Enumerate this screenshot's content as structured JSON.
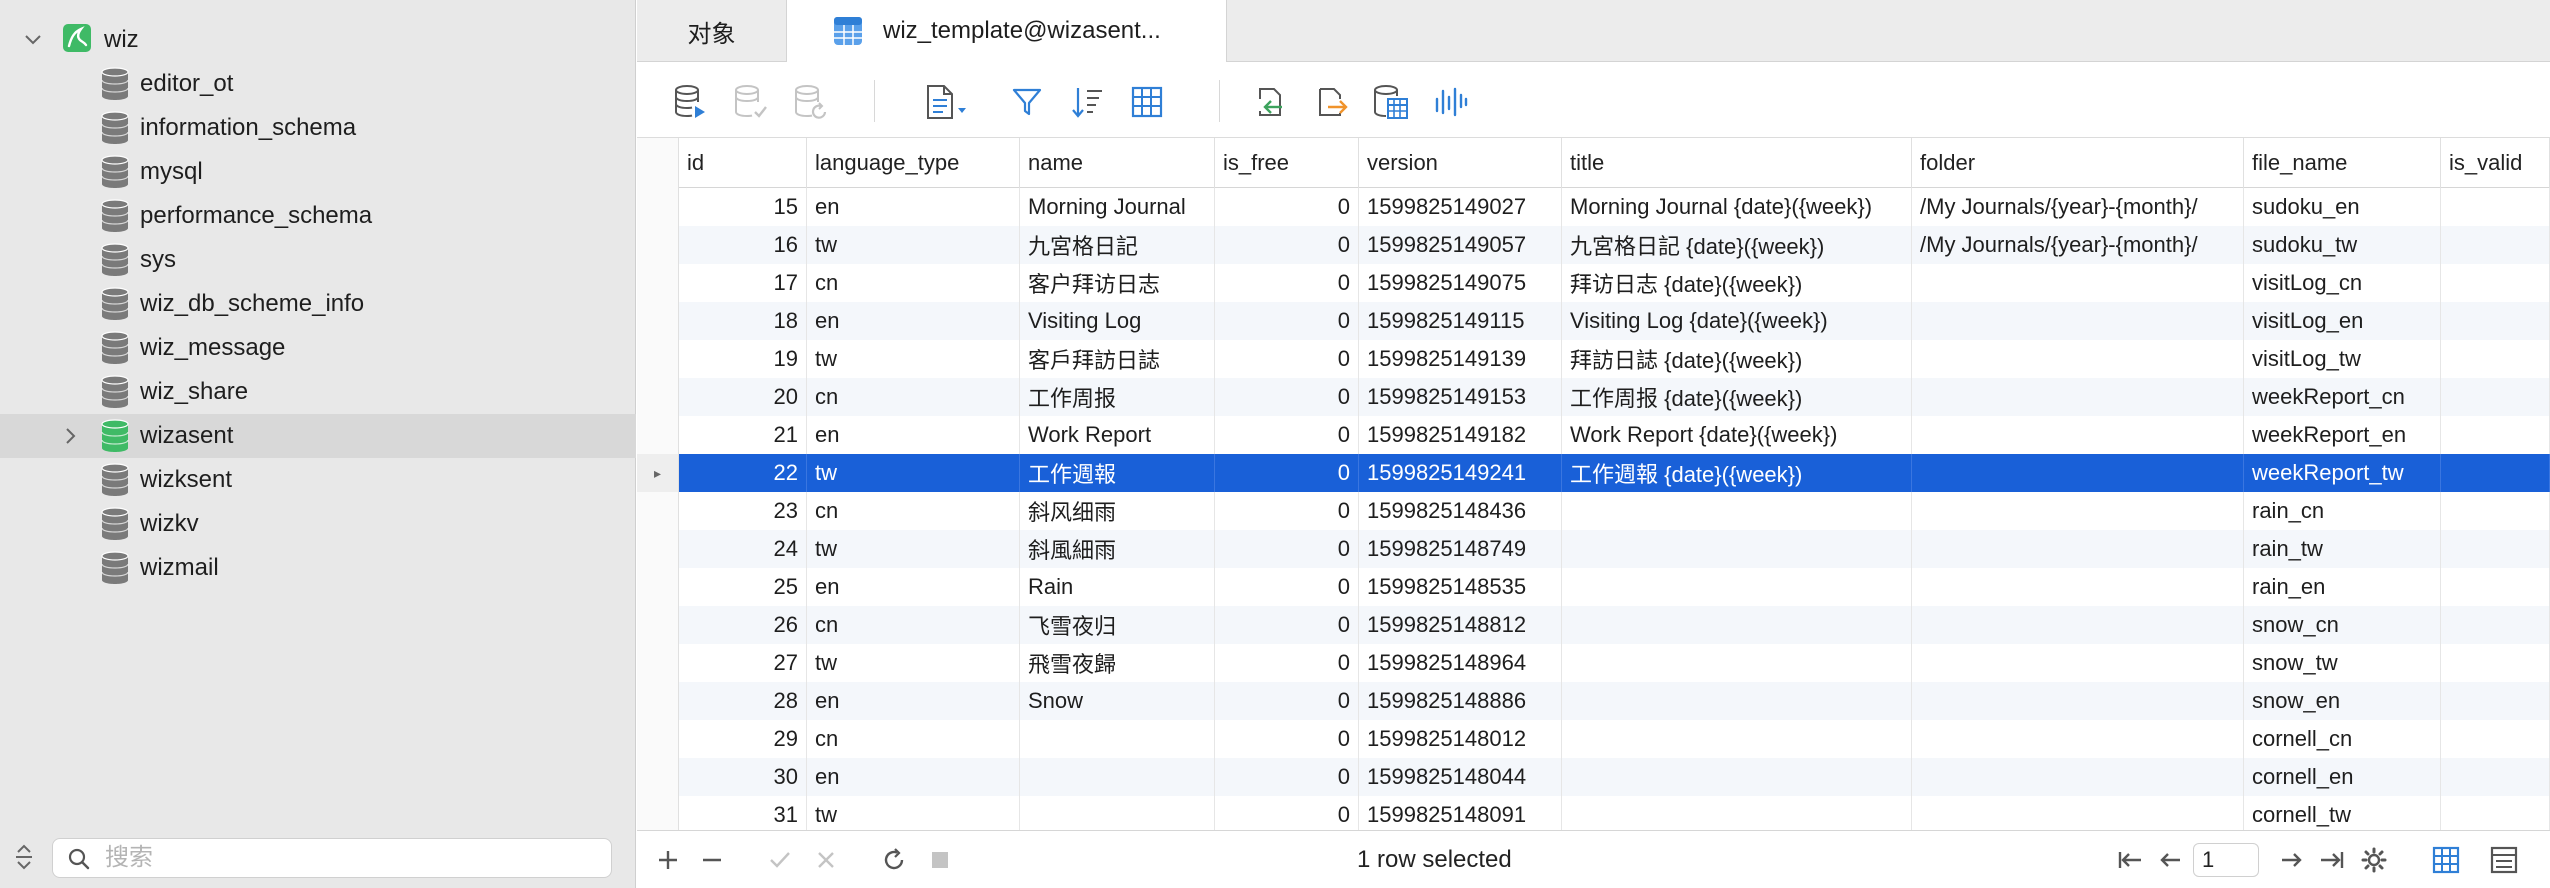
{
  "sidebar": {
    "root": {
      "label": "wiz"
    },
    "items": [
      {
        "label": "editor_ot"
      },
      {
        "label": "information_schema"
      },
      {
        "label": "mysql"
      },
      {
        "label": "performance_schema"
      },
      {
        "label": "sys"
      },
      {
        "label": "wiz_db_scheme_info"
      },
      {
        "label": "wiz_message"
      },
      {
        "label": "wiz_share"
      },
      {
        "label": "wizasent",
        "selected": true,
        "icon_color": "#3fba66"
      },
      {
        "label": "wizksent"
      },
      {
        "label": "wizkv"
      },
      {
        "label": "wizmail"
      }
    ],
    "search": {
      "placeholder": "搜索"
    }
  },
  "tabs": [
    {
      "label": "对象"
    },
    {
      "label": "wiz_template@wizasent..."
    }
  ],
  "toolbar": {
    "buttons": [
      {
        "icon": "database-run-icon"
      },
      {
        "icon": "database-stop-icon"
      },
      {
        "icon": "database-refresh-icon"
      },
      {
        "icon": "document-menu-icon"
      },
      {
        "icon": "filter-icon"
      },
      {
        "icon": "sort-icon"
      },
      {
        "icon": "grid-icon"
      },
      {
        "icon": "import-icon"
      },
      {
        "icon": "export-icon"
      },
      {
        "icon": "database-table-icon"
      },
      {
        "icon": "chart-icon"
      }
    ]
  },
  "grid": {
    "columns": [
      "id",
      "language_type",
      "name",
      "is_free",
      "version",
      "title",
      "folder",
      "file_name",
      "is_valid"
    ],
    "selected_index": 7,
    "rows": [
      {
        "id": "15",
        "language_type": "en",
        "name": "Morning Journal",
        "is_free": "0",
        "version": "1599825149027",
        "title": "Morning Journal {date}({week})",
        "folder": "/My Journals/{year}-{month}/",
        "file_name": "sudoku_en",
        "is_valid": ""
      },
      {
        "id": "16",
        "language_type": "tw",
        "name": "九宮格日記",
        "is_free": "0",
        "version": "1599825149057",
        "title": "九宮格日記 {date}({week})",
        "folder": "/My Journals/{year}-{month}/",
        "file_name": "sudoku_tw",
        "is_valid": ""
      },
      {
        "id": "17",
        "language_type": "cn",
        "name": "客户拜访日志",
        "is_free": "0",
        "version": "1599825149075",
        "title": "拜访日志 {date}({week})",
        "folder": "",
        "file_name": "visitLog_cn",
        "is_valid": ""
      },
      {
        "id": "18",
        "language_type": "en",
        "name": "Visiting Log",
        "is_free": "0",
        "version": "1599825149115",
        "title": "Visiting Log {date}({week})",
        "folder": "",
        "file_name": "visitLog_en",
        "is_valid": ""
      },
      {
        "id": "19",
        "language_type": "tw",
        "name": "客戶拜訪日誌",
        "is_free": "0",
        "version": "1599825149139",
        "title": "拜訪日誌 {date}({week})",
        "folder": "",
        "file_name": "visitLog_tw",
        "is_valid": ""
      },
      {
        "id": "20",
        "language_type": "cn",
        "name": "工作周报",
        "is_free": "0",
        "version": "1599825149153",
        "title": "工作周报 {date}({week})",
        "folder": "",
        "file_name": "weekReport_cn",
        "is_valid": ""
      },
      {
        "id": "21",
        "language_type": "en",
        "name": "Work Report",
        "is_free": "0",
        "version": "1599825149182",
        "title": "Work Report {date}({week})",
        "folder": "",
        "file_name": "weekReport_en",
        "is_valid": ""
      },
      {
        "id": "22",
        "language_type": "tw",
        "name": "工作週報",
        "is_free": "0",
        "version": "1599825149241",
        "title": "工作週報 {date}({week})",
        "folder": "",
        "file_name": "weekReport_tw",
        "is_valid": ""
      },
      {
        "id": "23",
        "language_type": "cn",
        "name": "斜风细雨",
        "is_free": "0",
        "version": "1599825148436",
        "title": "",
        "folder": "",
        "file_name": "rain_cn",
        "is_valid": ""
      },
      {
        "id": "24",
        "language_type": "tw",
        "name": "斜風細雨",
        "is_free": "0",
        "version": "1599825148749",
        "title": "",
        "folder": "",
        "file_name": "rain_tw",
        "is_valid": ""
      },
      {
        "id": "25",
        "language_type": "en",
        "name": "Rain",
        "is_free": "0",
        "version": "1599825148535",
        "title": "",
        "folder": "",
        "file_name": "rain_en",
        "is_valid": ""
      },
      {
        "id": "26",
        "language_type": "cn",
        "name": "飞雪夜归",
        "is_free": "0",
        "version": "1599825148812",
        "title": "",
        "folder": "",
        "file_name": "snow_cn",
        "is_valid": ""
      },
      {
        "id": "27",
        "language_type": "tw",
        "name": "飛雪夜歸",
        "is_free": "0",
        "version": "1599825148964",
        "title": "",
        "folder": "",
        "file_name": "snow_tw",
        "is_valid": ""
      },
      {
        "id": "28",
        "language_type": "en",
        "name": "Snow",
        "is_free": "0",
        "version": "1599825148886",
        "title": "",
        "folder": "",
        "file_name": "snow_en",
        "is_valid": ""
      },
      {
        "id": "29",
        "language_type": "cn",
        "name": "",
        "is_free": "0",
        "version": "1599825148012",
        "title": "",
        "folder": "",
        "file_name": "cornell_cn",
        "is_valid": ""
      },
      {
        "id": "30",
        "language_type": "en",
        "name": "",
        "is_free": "0",
        "version": "1599825148044",
        "title": "",
        "folder": "",
        "file_name": "cornell_en",
        "is_valid": ""
      },
      {
        "id": "31",
        "language_type": "tw",
        "name": "",
        "is_free": "0",
        "version": "1599825148091",
        "title": "",
        "folder": "",
        "file_name": "cornell_tw",
        "is_valid": ""
      }
    ]
  },
  "status": {
    "text": "1 row selected",
    "page": "1"
  },
  "colors": {
    "selection": "#1960d8",
    "db_icon": "#7a7a7a",
    "db_icon_active": "#3fba66",
    "toolbar_blue": "#2f7fd6",
    "toolbar_orange": "#f0932b",
    "toolbar_green": "#3da35d"
  }
}
